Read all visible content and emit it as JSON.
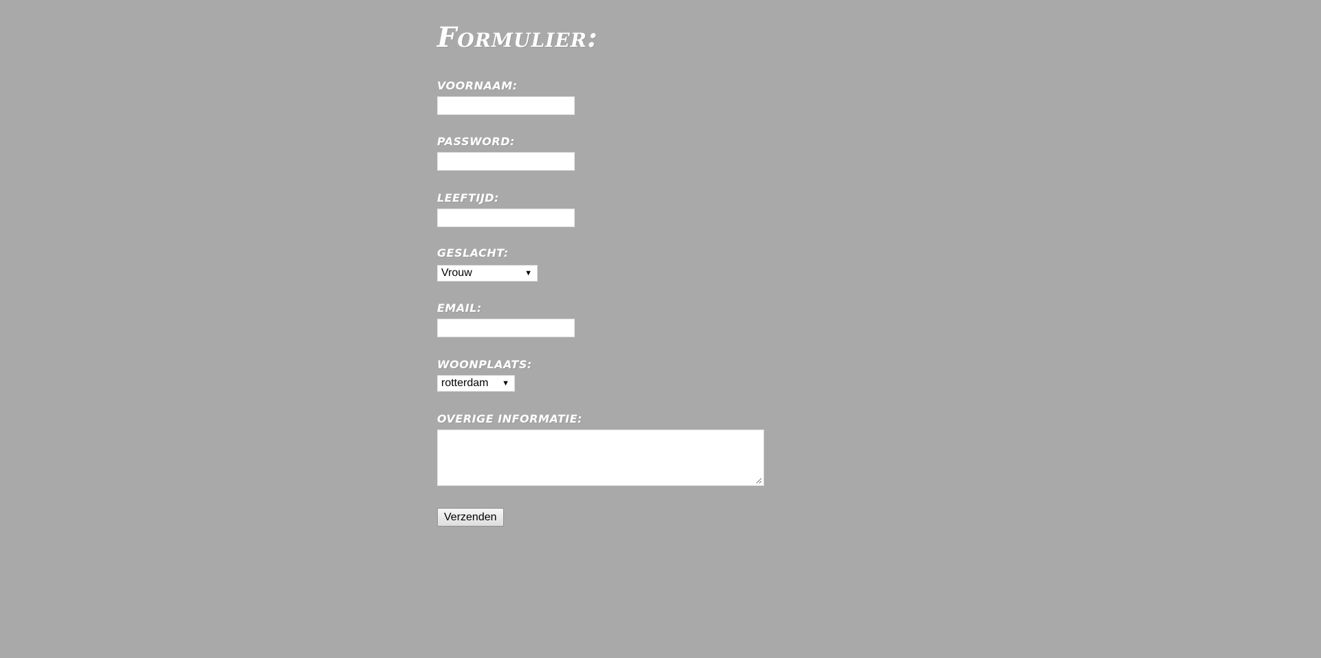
{
  "form": {
    "title": "Formulier:",
    "fields": {
      "voornaam": {
        "label": "voornaam:",
        "value": ""
      },
      "password": {
        "label": "password:",
        "value": ""
      },
      "leeftijd": {
        "label": "leeftijd:",
        "value": ""
      },
      "geslacht": {
        "label": "geslacht:",
        "selected": "Vrouw"
      },
      "email": {
        "label": "email:",
        "value": ""
      },
      "woonplaats": {
        "label": "woonplaats:",
        "selected": "rotterdam"
      },
      "overige": {
        "label": "overige informatie:",
        "value": ""
      }
    },
    "submit_label": "Verzenden"
  },
  "colors": {
    "background": "#a9a9a9",
    "text": "#ffffff",
    "field_background": "#ffffff"
  }
}
